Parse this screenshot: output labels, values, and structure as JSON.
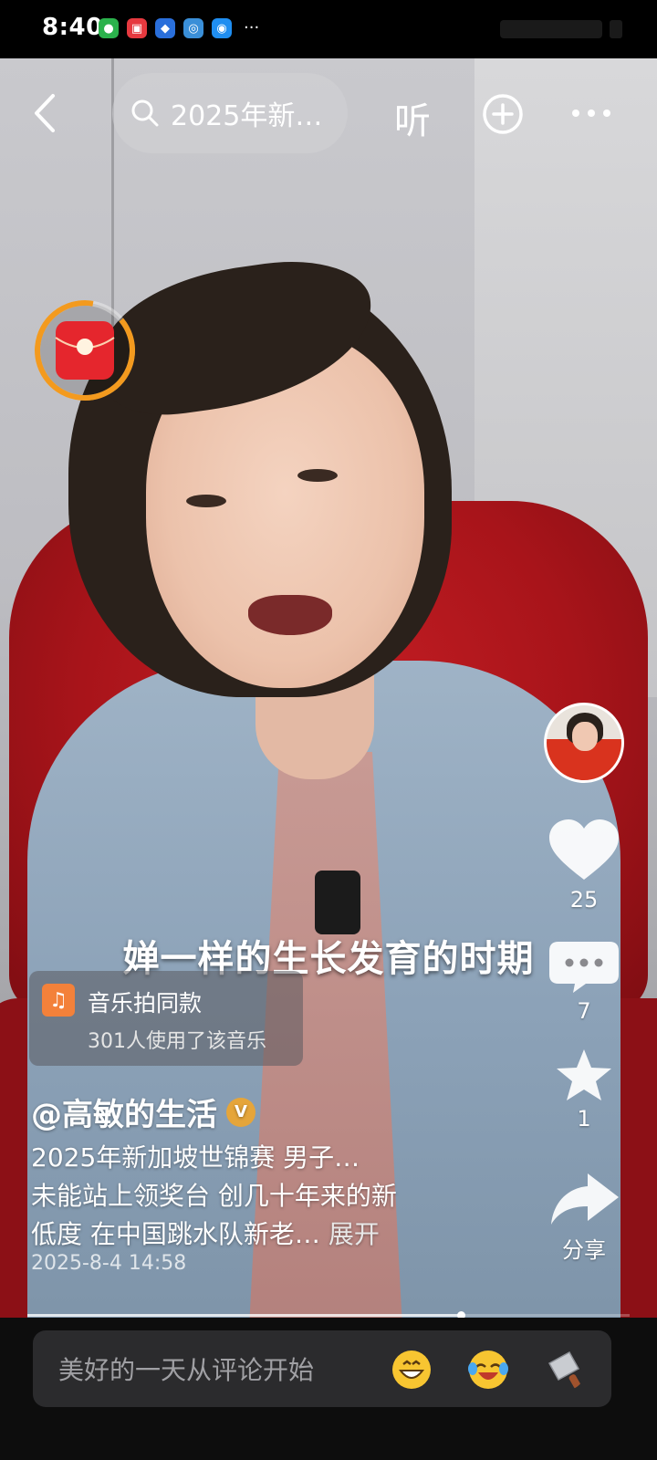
{
  "status_bar": {
    "time": "8:40",
    "more": "···"
  },
  "top_bar": {
    "search_text": "2025年新…",
    "listen_label": "听"
  },
  "video": {
    "subtitle": "婵一样的生长发育的时期"
  },
  "music": {
    "title": "音乐拍同款",
    "subtitle": "301人使用了该音乐"
  },
  "sidebar": {
    "like_count": "25",
    "comment_count": "7",
    "favorite_count": "1",
    "share_label": "分享"
  },
  "post": {
    "author": "@高敏的生活",
    "verified_mark": "V",
    "desc_line1": "2025年新加坡世锦赛 男子…",
    "desc_line2": "未能站上领奖台 创几十年来的新",
    "desc_line3": "低度 在中国跳水队新老…",
    "expand_label": "展开",
    "date": "2025-8-4 14:58"
  },
  "playback": {
    "progress": 0.72
  },
  "comment_bar": {
    "placeholder": "美好的一天从评论开始"
  },
  "colors": {
    "accent_orange": "#f39a1e",
    "red_packet": "#e5262d",
    "music_icon": "#f3813a",
    "verified": "#e5a53a"
  }
}
